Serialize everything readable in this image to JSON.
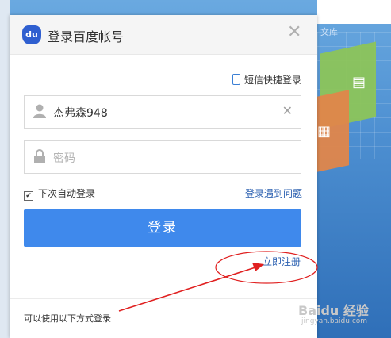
{
  "background": {
    "wenku_text": "文库",
    "watermark": "Baidu 经验",
    "watermark_sub": "jingyan.baidu.com"
  },
  "dialog": {
    "logo_text": "du",
    "title": "登录百度帐号",
    "close_glyph": "✕",
    "sms_login": "短信快捷登录",
    "username_value": "杰弗森948",
    "password_placeholder": "密码",
    "clear_glyph": "✕",
    "auto_login": "下次自动登录",
    "auto_login_checked": true,
    "login_trouble": "登录遇到问题",
    "login_button": "登录",
    "register": "立即注册",
    "other_methods": "可以使用以下方式登录"
  },
  "colors": {
    "accent": "#3f89ec",
    "link": "#2a5fb0",
    "annotation": "#e02020"
  },
  "icons": {
    "user": "user-icon",
    "lock": "lock-icon",
    "phone": "phone-icon",
    "close": "close-icon",
    "clear": "clear-icon"
  }
}
